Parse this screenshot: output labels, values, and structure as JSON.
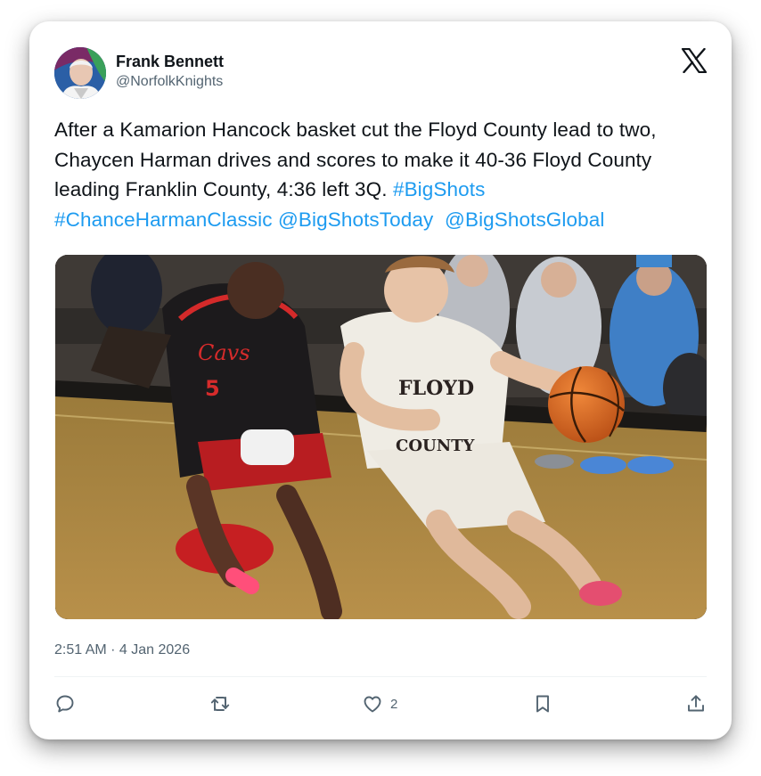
{
  "author": {
    "name": "Frank Bennett",
    "handle": "@NorfolkKnights"
  },
  "tweet": {
    "text_plain": "After a Kamarion Hancock basket cut the Floyd County lead to two, Chaycen Harman drives and scores to make it 40-36 Floyd County leading Franklin County, 4:36 left 3Q.",
    "hashtag_1": "#BigShots",
    "hashtag_2": "#ChanceHarmanClassic",
    "mention_1": "@BigShotsToday",
    "mention_2": "@BigShotsGlobal"
  },
  "media": {
    "jersey_text_top": "FLOYD",
    "jersey_text_bottom": "COUNTY",
    "opponent_jersey_text": "Cavs",
    "opponent_number": "5"
  },
  "meta": {
    "timestamp": "2:51 AM · 4 Jan 2026"
  },
  "actions": {
    "like_count": "2"
  },
  "icons": {
    "logo": "x-logo-icon",
    "reply": "reply-icon",
    "retweet": "retweet-icon",
    "like": "heart-icon",
    "bookmark": "bookmark-icon",
    "share": "share-icon"
  },
  "colors": {
    "link": "#1d9bf0",
    "text": "#0f1419",
    "secondary": "#536471"
  }
}
